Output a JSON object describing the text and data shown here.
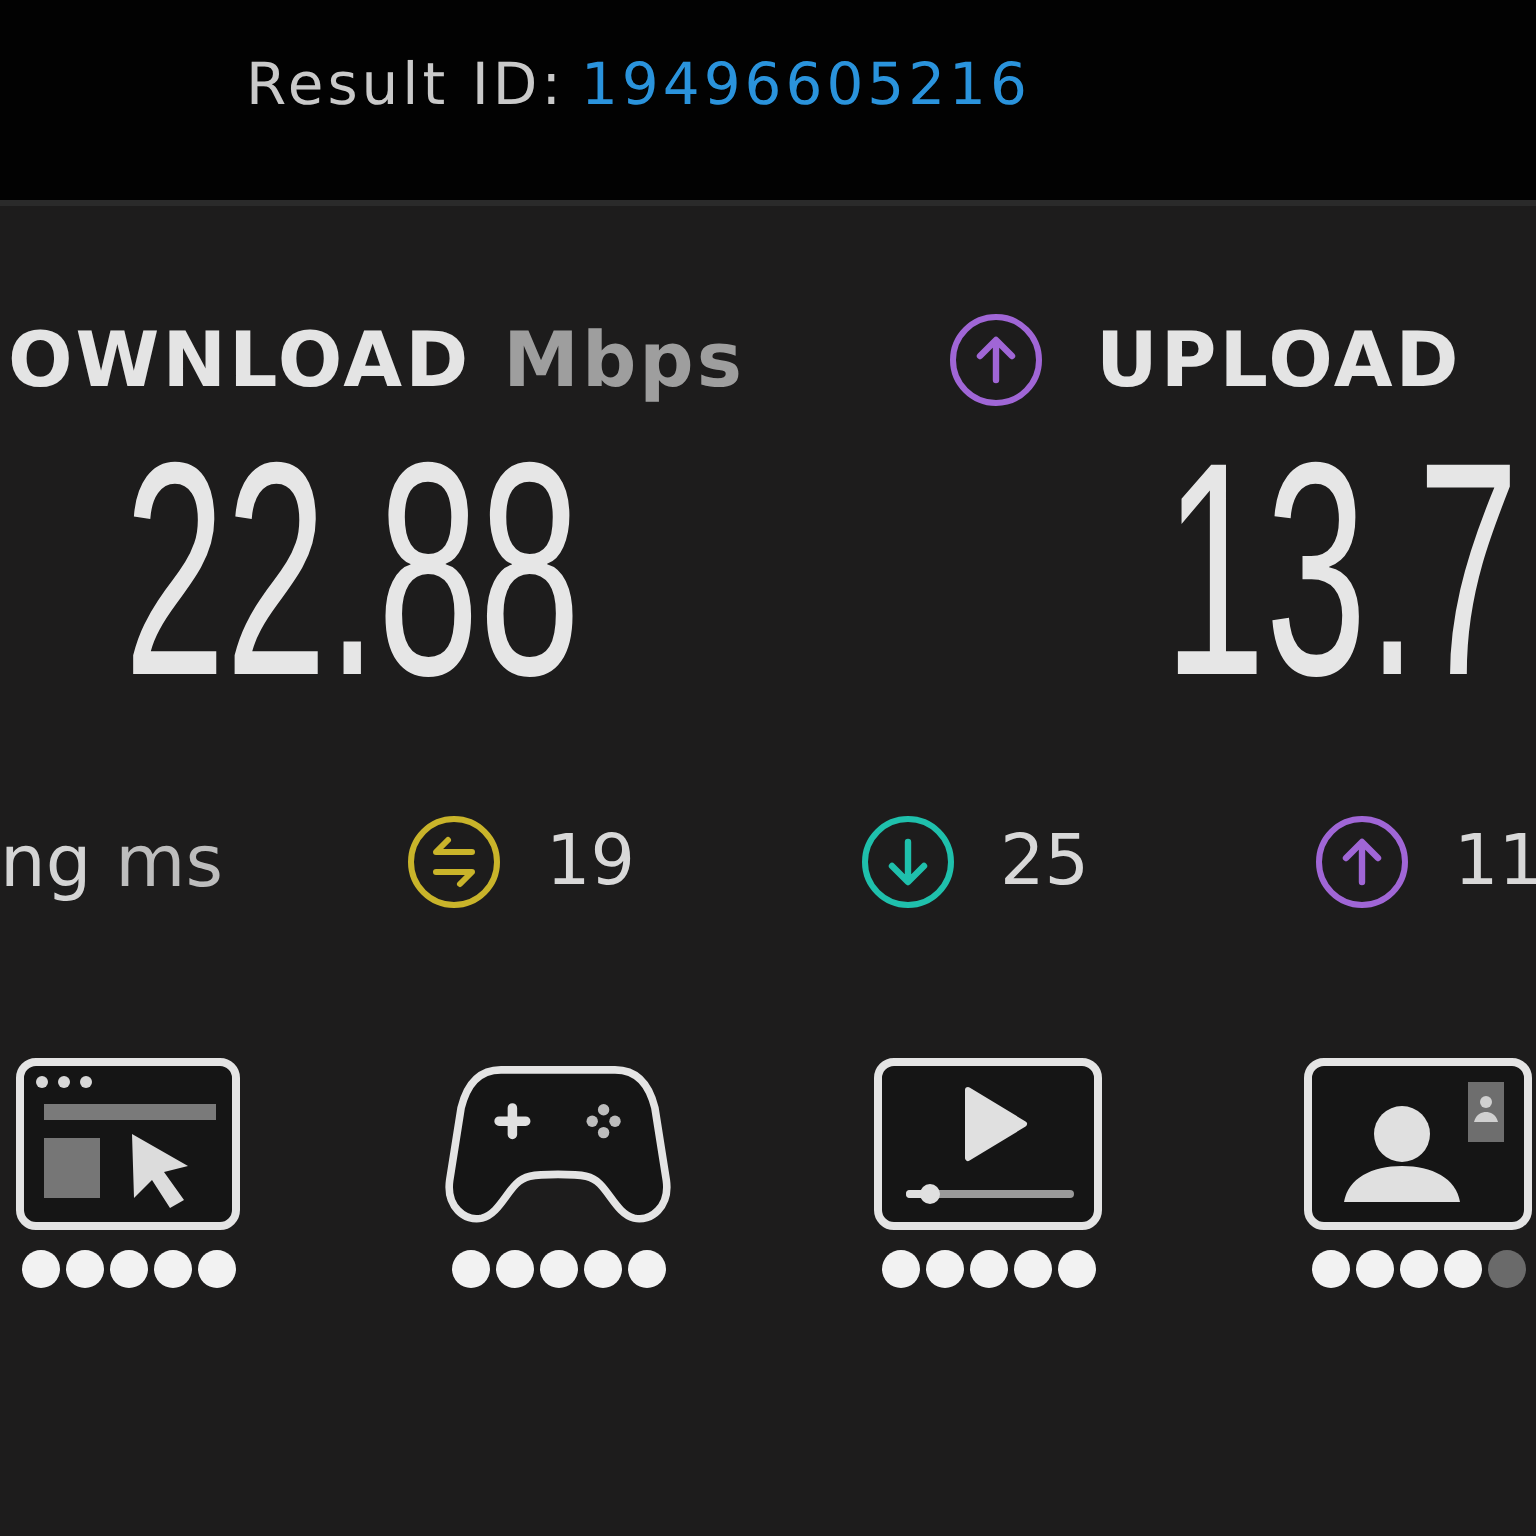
{
  "header": {
    "label": "Result ID:",
    "result_id": "19496605216"
  },
  "speeds": [
    {
      "kind": "download",
      "label": "OWNLOAD",
      "unit": "Mbps",
      "value": "22.88"
    },
    {
      "kind": "upload",
      "label": "UPLOAD",
      "value": "13.7"
    }
  ],
  "ping": {
    "label": "ng",
    "unit": "ms",
    "readings": [
      {
        "kind": "idle",
        "value": "19"
      },
      {
        "kind": "download",
        "value": "25"
      },
      {
        "kind": "upload",
        "value": "11"
      }
    ]
  },
  "services": [
    {
      "kind": "web",
      "stars": 5
    },
    {
      "kind": "gaming",
      "stars": 5
    },
    {
      "kind": "video",
      "stars": 5
    },
    {
      "kind": "video_call",
      "stars": 4
    }
  ]
}
